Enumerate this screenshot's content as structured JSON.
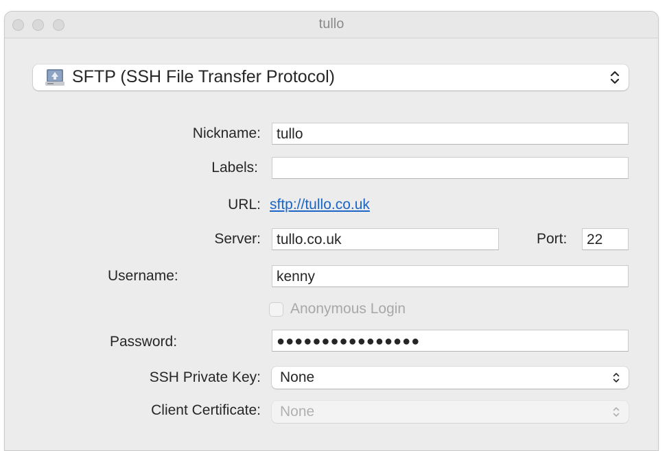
{
  "window": {
    "title": "tullo"
  },
  "protocol": {
    "selected": "SFTP (SSH File Transfer Protocol)",
    "icon": "network-drive-icon"
  },
  "form": {
    "nickname_label": "Nickname:",
    "nickname_value": "tullo",
    "labels_label": "Labels:",
    "labels_value": "",
    "url_label": "URL:",
    "url_value": "sftp://tullo.co.uk",
    "server_label": "Server:",
    "server_value": "tullo.co.uk",
    "port_label": "Port:",
    "port_value": "22",
    "username_label": "Username:",
    "username_value": "kenny",
    "anonymous_label": "Anonymous Login",
    "anonymous_checked": false,
    "password_label": "Password:",
    "password_masked": "●●●●●●●●●●●●●●●●",
    "ssh_key_label": "SSH Private Key:",
    "ssh_key_value": "None",
    "client_cert_label": "Client Certificate:",
    "client_cert_value": "None"
  },
  "colors": {
    "link": "#1a64c6",
    "window_bg": "#ececec",
    "disabled_text": "#a8a8a8"
  }
}
